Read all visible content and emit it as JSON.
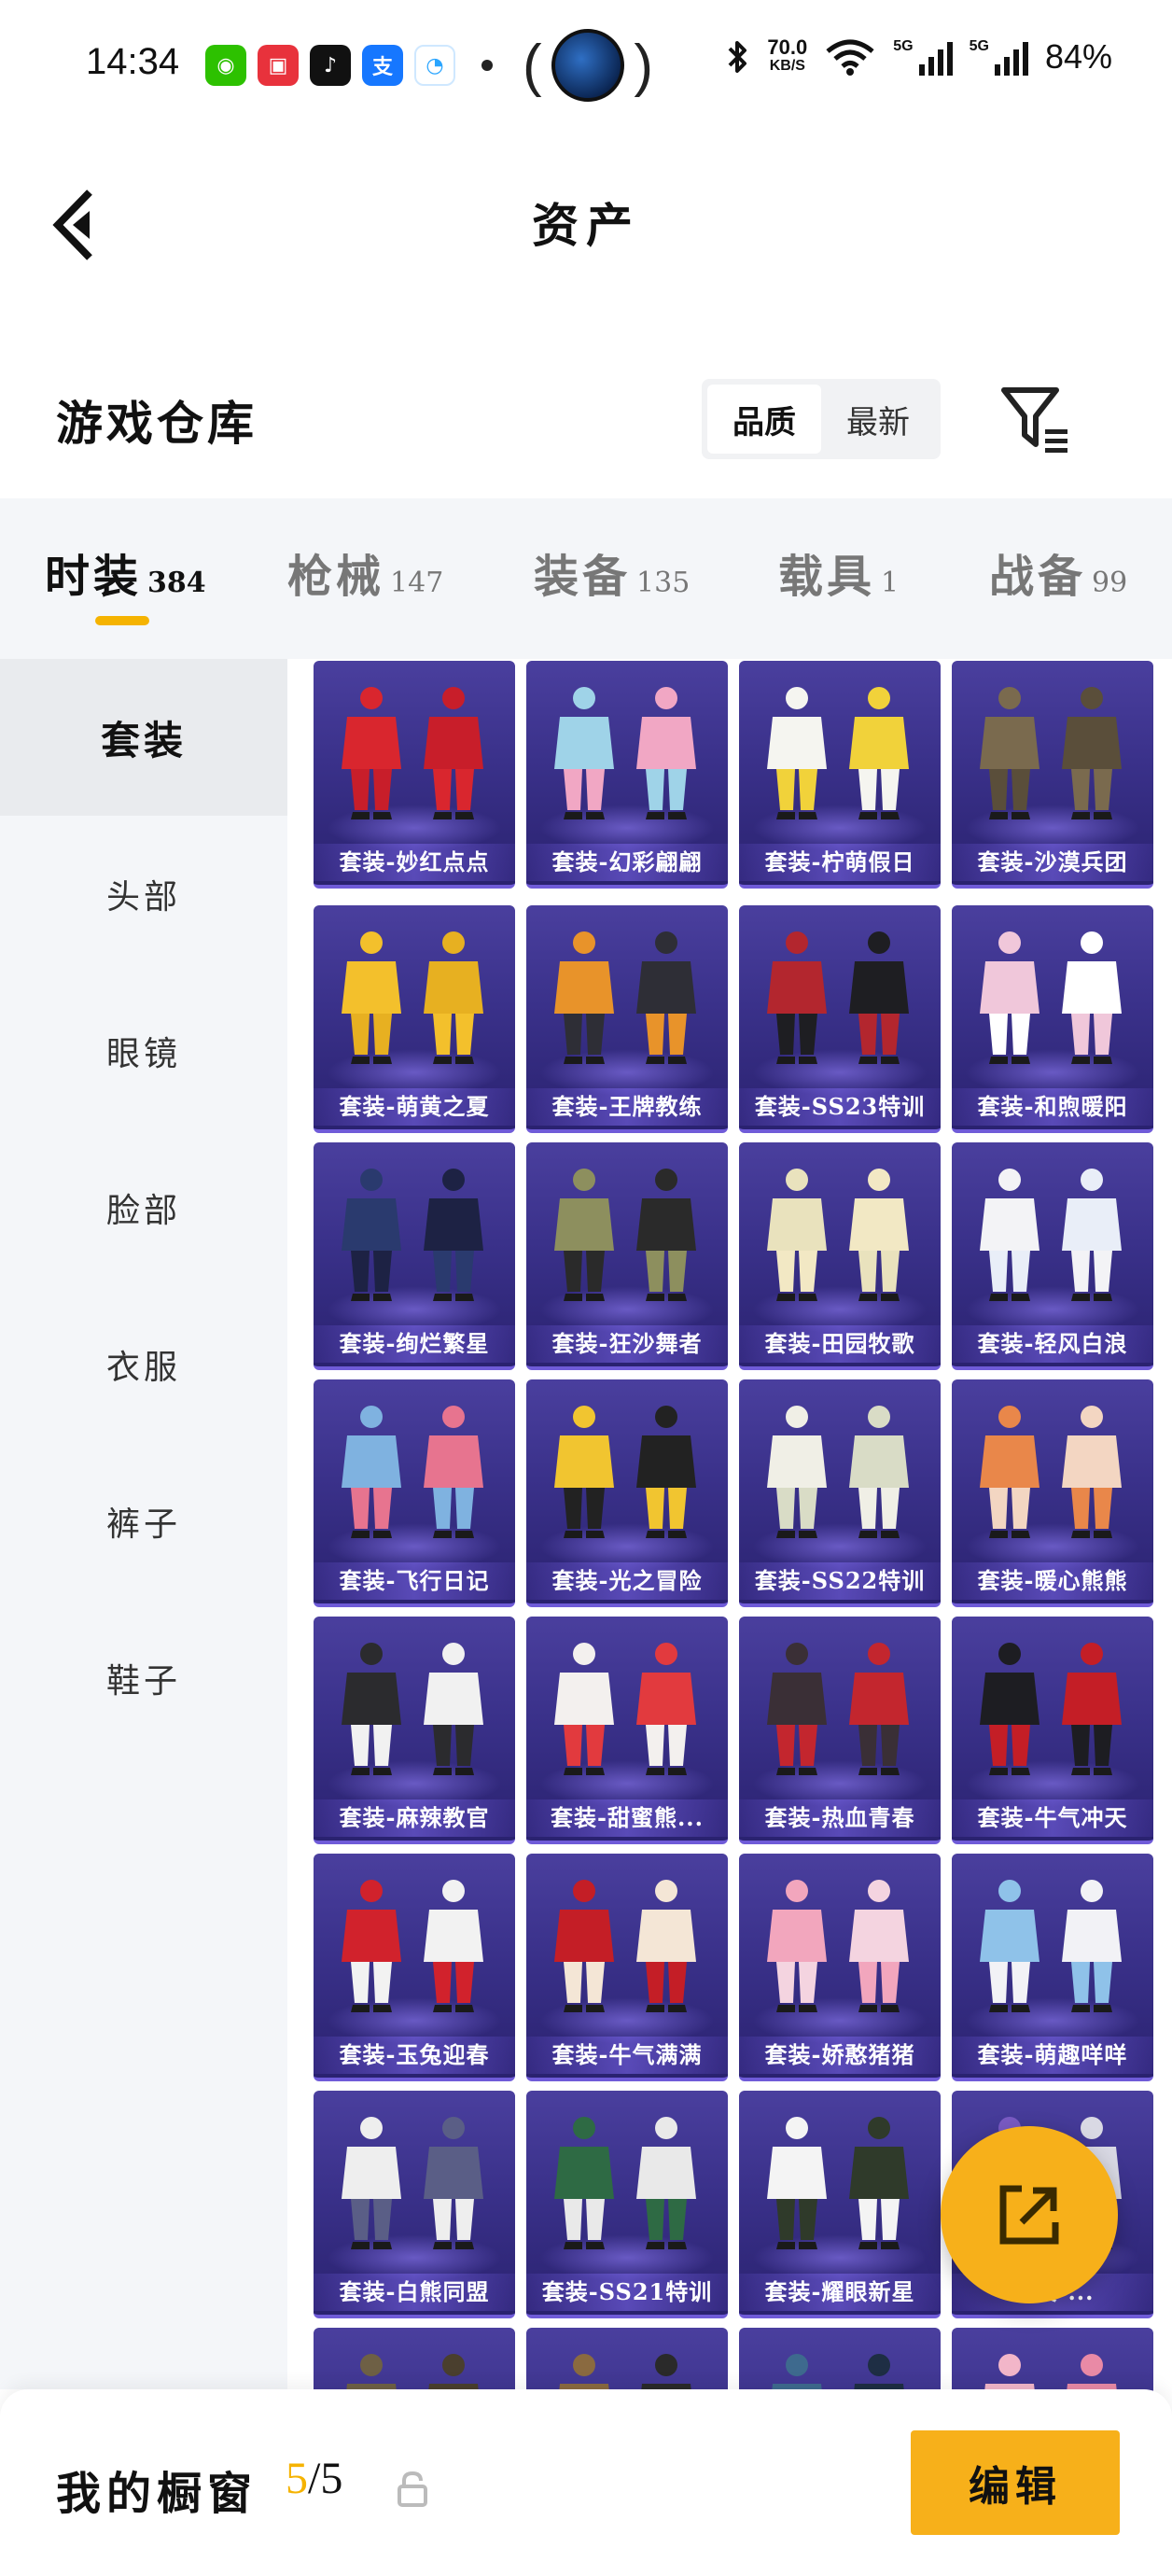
{
  "status_bar": {
    "time": "14:34",
    "net_speed": "70.0",
    "net_unit": "KB/S",
    "signal_1": "5G",
    "signal_2": "5G",
    "battery": "84%"
  },
  "header": {
    "title": "资产"
  },
  "warehouse": {
    "title": "游戏仓库",
    "sort_options": [
      "品质",
      "最新"
    ],
    "active_sort": "品质"
  },
  "category_tabs": [
    {
      "label": "时装",
      "count": "384",
      "active": true
    },
    {
      "label": "枪械",
      "count": "147",
      "active": false
    },
    {
      "label": "装备",
      "count": "135",
      "active": false
    },
    {
      "label": "载具",
      "count": "1",
      "active": false
    },
    {
      "label": "战备",
      "count": "99",
      "active": false
    }
  ],
  "sidebar": {
    "items": [
      {
        "label": "套装",
        "active": true
      },
      {
        "label": "头部",
        "active": false
      },
      {
        "label": "眼镜",
        "active": false
      },
      {
        "label": "脸部",
        "active": false
      },
      {
        "label": "衣服",
        "active": false
      },
      {
        "label": "裤子",
        "active": false
      },
      {
        "label": "鞋子",
        "active": false
      }
    ]
  },
  "items": [
    {
      "name": "套装-妙红点点",
      "colors": [
        "#d9262e",
        "#c81e2a"
      ]
    },
    {
      "name": "套装-幻彩翩翩",
      "colors": [
        "#9fd3e8",
        "#f1a7c4"
      ]
    },
    {
      "name": "套装-柠萌假日",
      "colors": [
        "#f5f5f0",
        "#f1d23a"
      ]
    },
    {
      "name": "套装-沙漠兵团",
      "colors": [
        "#7a6a4e",
        "#5a4e3a"
      ]
    },
    {
      "name": "套装-萌黄之夏",
      "colors": [
        "#f3c02c",
        "#e7b021"
      ]
    },
    {
      "name": "套装-王牌教练",
      "colors": [
        "#e8932a",
        "#2e2e36"
      ]
    },
    {
      "name": "套装-SS23特训",
      "colors": [
        "#b3262e",
        "#1e1e22"
      ]
    },
    {
      "name": "套装-和煦暖阳",
      "colors": [
        "#f0c7da",
        "#ffffff"
      ]
    },
    {
      "name": "套装-绚烂繁星",
      "colors": [
        "#2a3a6e",
        "#1d2244"
      ]
    },
    {
      "name": "套装-狂沙舞者",
      "colors": [
        "#8d8f5e",
        "#2a2a2a"
      ]
    },
    {
      "name": "套装-田园牧歌",
      "colors": [
        "#e9e2bd",
        "#f2e8c4"
      ]
    },
    {
      "name": "套装-轻风白浪",
      "colors": [
        "#f3f3f6",
        "#e9eef8"
      ]
    },
    {
      "name": "套装-飞行日记",
      "colors": [
        "#7fb2e0",
        "#e7748f"
      ]
    },
    {
      "name": "套装-光之冒险",
      "colors": [
        "#f1c530",
        "#222222"
      ]
    },
    {
      "name": "套装-SS22特训",
      "colors": [
        "#f0efe6",
        "#d9dcc6"
      ]
    },
    {
      "name": "套装-暖心熊熊",
      "colors": [
        "#e9874a",
        "#f3d6c2"
      ]
    },
    {
      "name": "套装-麻辣教官",
      "colors": [
        "#2b2b2e",
        "#f1f1f1"
      ]
    },
    {
      "name": "套装-甜蜜熊...",
      "colors": [
        "#f3f0ee",
        "#e23a3e"
      ]
    },
    {
      "name": "套装-热血青春",
      "colors": [
        "#3a2f36",
        "#c3262e"
      ]
    },
    {
      "name": "套装-牛气冲天",
      "colors": [
        "#1d1d22",
        "#c41e26"
      ]
    },
    {
      "name": "套装-玉兔迎春",
      "colors": [
        "#d1222c",
        "#f2f2f2"
      ]
    },
    {
      "name": "套装-牛气满满",
      "colors": [
        "#c41e26",
        "#f4e6d6"
      ]
    },
    {
      "name": "套装-娇憨猪猪",
      "colors": [
        "#f2a6bd",
        "#f4d4e0"
      ]
    },
    {
      "name": "套装-萌趣咩咩",
      "colors": [
        "#8fc2e9",
        "#f2f2f6"
      ]
    },
    {
      "name": "套装-白熊同盟",
      "colors": [
        "#eeeeee",
        "#5a5e86"
      ]
    },
    {
      "name": "套装-SS21特训",
      "colors": [
        "#2e6a44",
        "#e9e9e9"
      ]
    },
    {
      "name": "套装-耀眼新星",
      "colors": [
        "#f4f4f4",
        "#2f3a2a"
      ]
    },
    {
      "name": "套装-...",
      "colors": [
        "#7a5bc4",
        "#d9d9e4"
      ]
    },
    {
      "name": "",
      "colors": [
        "#6e6045",
        "#4a3f2e"
      ]
    },
    {
      "name": "",
      "colors": [
        "#8a6a40",
        "#2a2a2a"
      ]
    },
    {
      "name": "",
      "colors": [
        "#3e6a8e",
        "#1e2e44"
      ]
    },
    {
      "name": "",
      "colors": [
        "#f2b6c9",
        "#e98aa6"
      ]
    }
  ],
  "bottom_bar": {
    "showcase_label": "我的橱窗",
    "showcase_current": "5",
    "showcase_total": "/5",
    "edit_label": "编辑"
  }
}
